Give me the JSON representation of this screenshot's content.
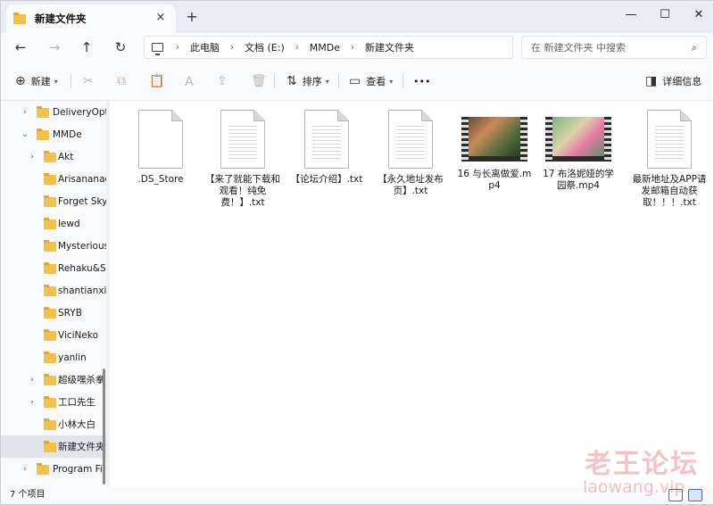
{
  "window": {
    "tab_title": "新建文件夹",
    "close_tab": "×",
    "new_tab": "+",
    "minimize": "—",
    "maximize": "☐",
    "close": "✕"
  },
  "nav": {
    "back": "←",
    "forward": "→",
    "up": "↑",
    "refresh": "↻",
    "breadcrumbs": [
      "此电脑",
      "文档 (E:)",
      "MMDe",
      "新建文件夹"
    ],
    "search_placeholder": "在 新建文件夹 中搜索"
  },
  "toolbar": {
    "new_label": "新建",
    "sort_label": "排序",
    "view_label": "查看",
    "more": "•••",
    "details_label": "详细信息"
  },
  "sidebar": {
    "items": [
      {
        "label": "DeliveryOpt",
        "chevron": "›",
        "level": 1
      },
      {
        "label": "MMDe",
        "chevron": "⌄",
        "level": 1
      },
      {
        "label": "Akt",
        "chevron": "›",
        "level": 2
      },
      {
        "label": "Arisananac",
        "chevron": "",
        "level": 2
      },
      {
        "label": "Forget Sky",
        "chevron": "",
        "level": 2
      },
      {
        "label": "lewd",
        "chevron": "",
        "level": 2
      },
      {
        "label": "Mysterious",
        "chevron": "",
        "level": 2
      },
      {
        "label": "Rehaku&S",
        "chevron": "",
        "level": 2
      },
      {
        "label": "shantianxia",
        "chevron": "",
        "level": 2
      },
      {
        "label": "SRYB",
        "chevron": "",
        "level": 2
      },
      {
        "label": "ViciNeko",
        "chevron": "",
        "level": 2
      },
      {
        "label": "yanlin",
        "chevron": "",
        "level": 2
      },
      {
        "label": "超级嘿杀拳",
        "chevron": "›",
        "level": 2
      },
      {
        "label": "工口先生",
        "chevron": "›",
        "level": 2
      },
      {
        "label": "小林大白",
        "chevron": "",
        "level": 2
      },
      {
        "label": "新建文件夹",
        "chevron": "",
        "level": 2,
        "selected": true
      },
      {
        "label": "Program Fil",
        "chevron": "›",
        "level": 1
      }
    ]
  },
  "files": [
    {
      "name": ".DS_Store",
      "type": "blank"
    },
    {
      "name": "【来了就能下载和观看！纯免费！】.txt",
      "type": "txt"
    },
    {
      "name": "【论坛介绍】.txt",
      "type": "txt"
    },
    {
      "name": "【永久地址发布页】.txt",
      "type": "txt"
    },
    {
      "name": "16 与长离做爱.mp4",
      "type": "video"
    },
    {
      "name": "17 布洛妮娅的学园祭.mp4",
      "type": "video"
    },
    {
      "name": "最新地址及APP请发邮箱自动获取！！！.txt",
      "type": "txt"
    }
  ],
  "status": {
    "count_text": "7 个项目"
  },
  "watermark": {
    "line1": "老王论坛",
    "line2": "laowang.vip"
  }
}
